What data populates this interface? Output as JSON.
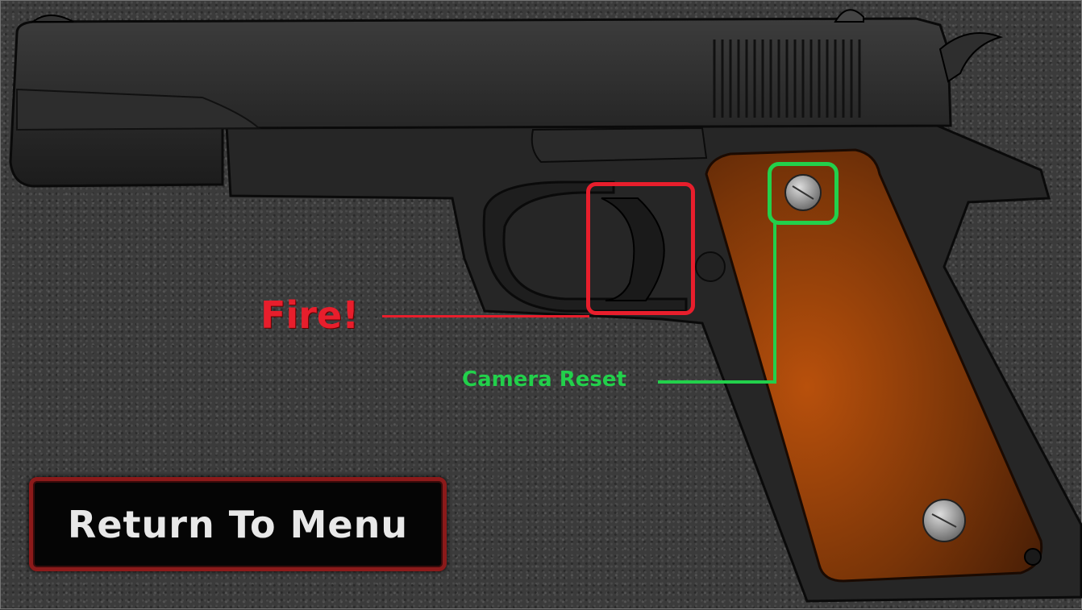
{
  "controls": {
    "fire_label": "Fire!",
    "camera_reset_label": "Camera Reset",
    "return_menu_label": "Return To Menu"
  },
  "colors": {
    "fire": "#e81e2c",
    "camera_reset": "#22d04b",
    "menu_border": "#8b1a1a",
    "grip": "#8a3a08"
  },
  "scene": {
    "object": "pistol-icon"
  }
}
